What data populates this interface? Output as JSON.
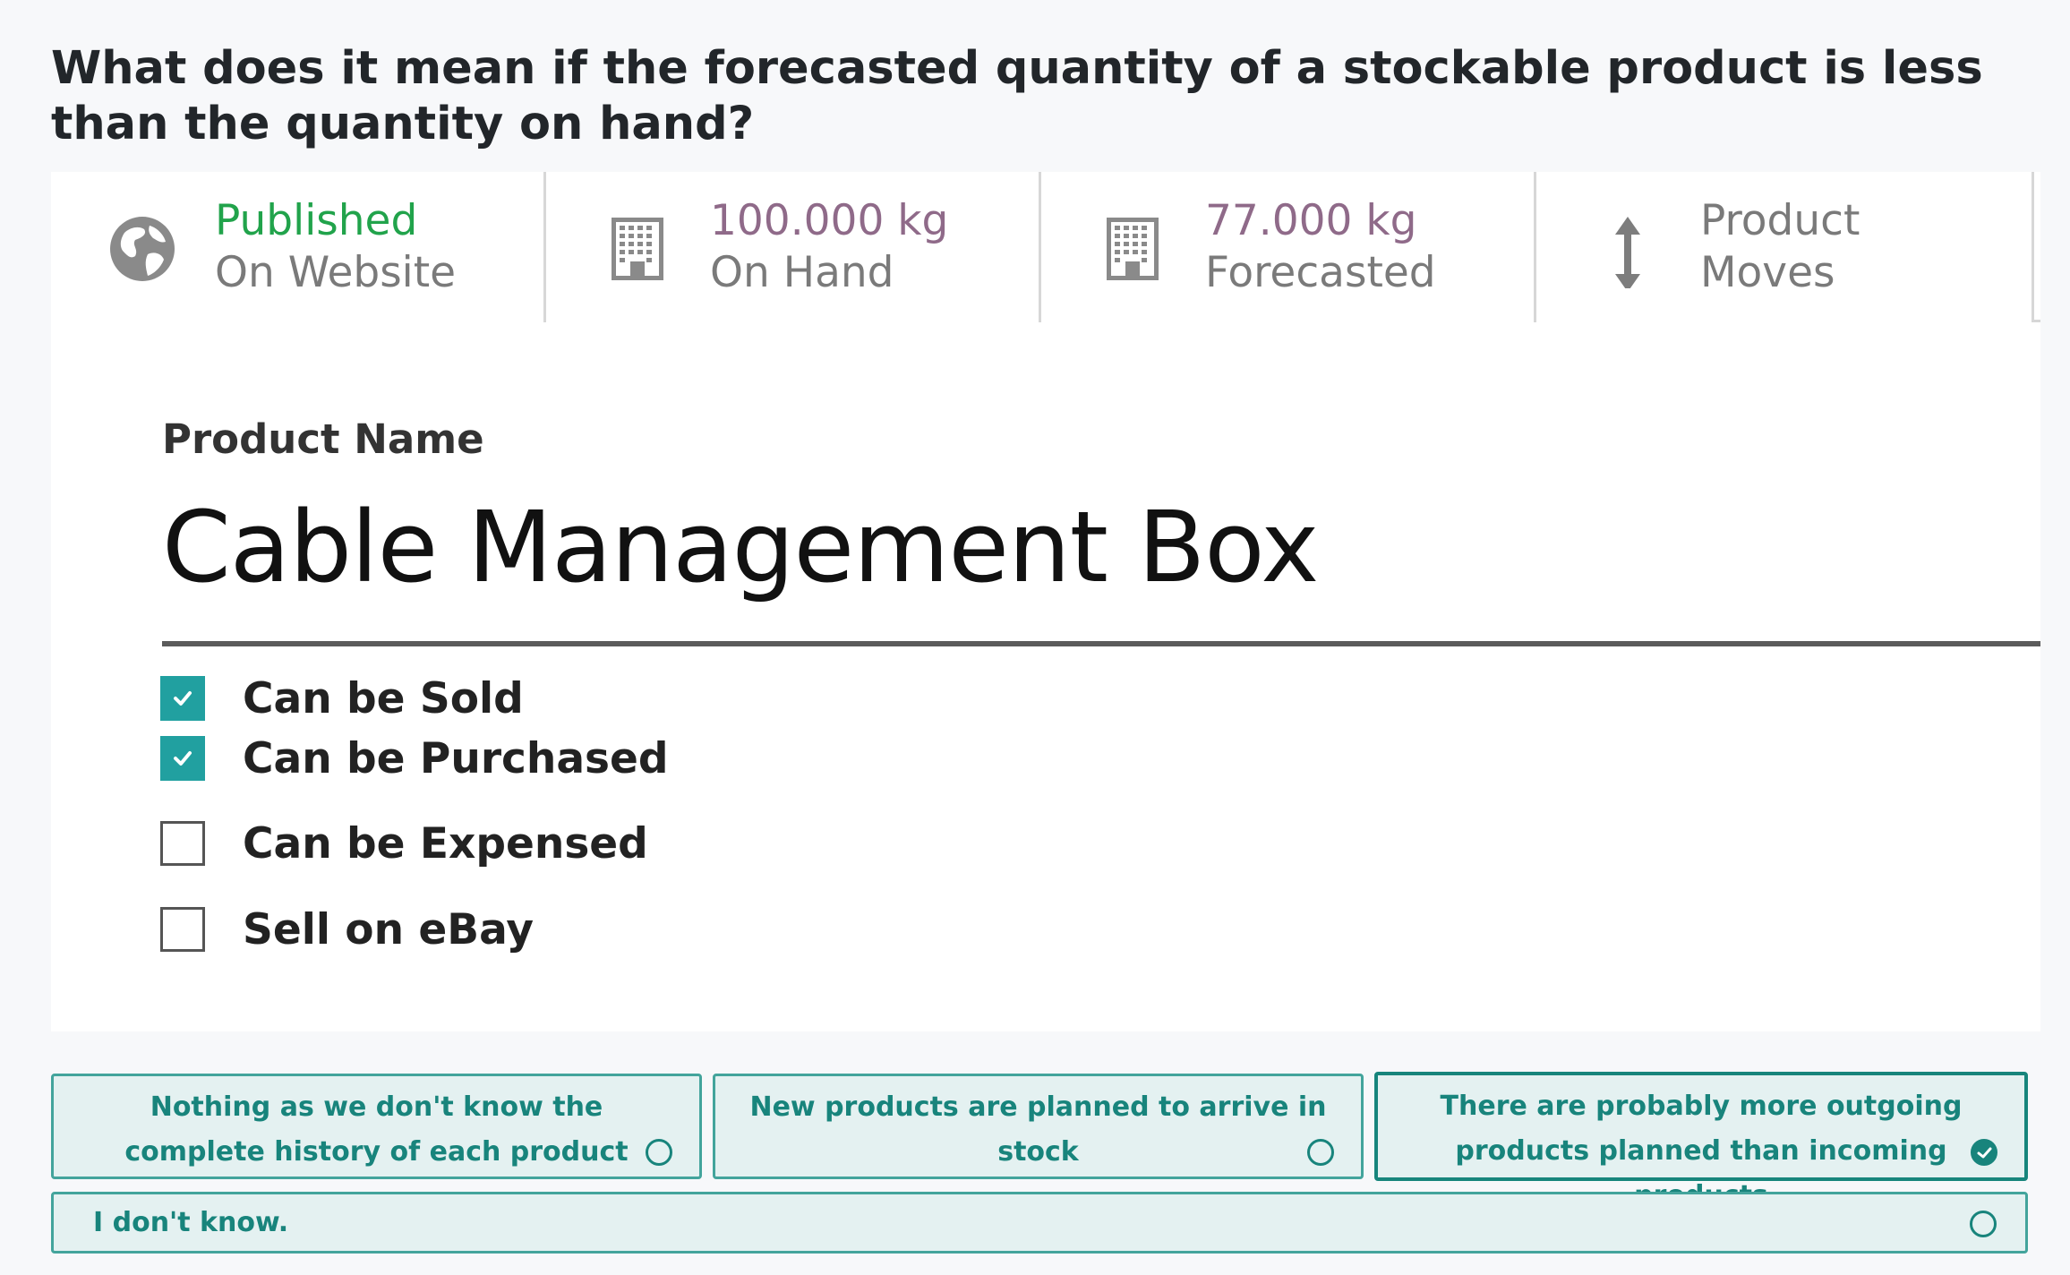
{
  "question": "What does it mean if the forecasted quantity of a stockable product is less than the quantity on hand?",
  "stat_buttons": [
    {
      "line1": "Published",
      "line2": "On Website",
      "icon": "globe-icon"
    },
    {
      "line1": "100.000 kg",
      "line2": "On Hand",
      "icon": "warehouse-icon"
    },
    {
      "line1": "77.000 kg",
      "line2": "Forecasted",
      "icon": "warehouse-icon"
    },
    {
      "line1": "Product",
      "line2": "Moves",
      "icon": "up-down-arrow-icon"
    }
  ],
  "form": {
    "label": "Product Name",
    "product_name": "Cable Management Box",
    "checkboxes": [
      {
        "label": "Can be Sold",
        "checked": true
      },
      {
        "label": "Can be Purchased",
        "checked": true
      },
      {
        "label": "Can be Expensed",
        "checked": false
      },
      {
        "label": "Sell on eBay",
        "checked": false
      }
    ]
  },
  "answers": [
    {
      "text": "Nothing as we don't know the complete history of each product",
      "selected": false
    },
    {
      "text": "New products are planned to arrive in stock",
      "selected": false
    },
    {
      "text": "There are probably more outgoing products planned than incoming products",
      "selected": true
    },
    {
      "text": "I don't know.",
      "selected": false
    }
  ],
  "colors": {
    "accent": "#18847c",
    "answer_bg": "#e4f1f1",
    "published_green": "#21a34b",
    "stat_value_purple": "#8f6a89",
    "checkbox_teal": "#21a0a0"
  }
}
